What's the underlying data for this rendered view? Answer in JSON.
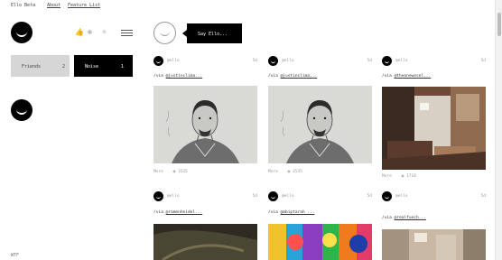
{
  "topbar": {
    "title": "Ello Beta",
    "about": "About",
    "feature_list": "Feature List"
  },
  "sidebar": {
    "friends_label": "Friends",
    "friends_count": "2",
    "noise_label": "Noise",
    "noise_count": "1",
    "footer": "WTF"
  },
  "compose": {
    "say_label": "Say Ello..."
  },
  "posts": [
    {
      "user": "@ello",
      "time": "5d",
      "via_prefix": "/via",
      "via_user": "@justinclima...",
      "more": "More",
      "views": "3535"
    },
    {
      "user": "@ello",
      "time": "5d",
      "via_prefix": "/via",
      "via_user": "@justinclima...",
      "more": "More",
      "views": "3535"
    },
    {
      "user": "@ello",
      "time": "5d",
      "via_prefix": "/via",
      "via_user": "@theonewesel...",
      "more": "More",
      "views": "1718"
    },
    {
      "user": "@ello",
      "time": "5d",
      "via_prefix": "/via",
      "via_user": "@ramenheidel...",
      "more": "",
      "views": ""
    },
    {
      "user": "@ello",
      "time": "5d",
      "via_prefix": "/via",
      "via_user": "@abiptarah ...",
      "more": "",
      "views": ""
    },
    {
      "user": "@ello",
      "time": "5d",
      "via_prefix": "/via",
      "via_user": "@realfuech...",
      "more": "",
      "views": ""
    }
  ],
  "icons": [
    "thumb-icon",
    "explore-icon",
    "globe-icon",
    "menu-icon",
    "eye-icon"
  ],
  "colors": {
    "accent": "#000000",
    "friends_bg": "#d6d6d6",
    "noise_bg": "#000000",
    "muted": "#999999"
  }
}
